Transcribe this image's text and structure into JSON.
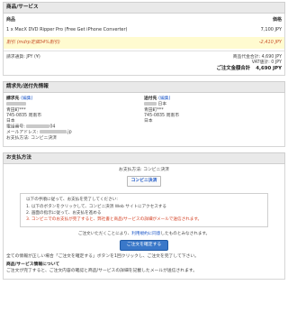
{
  "products": {
    "section_title": "商品/サービス",
    "col_product": "商品",
    "col_price": "価格",
    "item_name": "1 x MacX DVD Ripper Pro (Free Get iPhone Converter)",
    "item_price": "7,100 JPY",
    "discount_label": "割引 (mdrp定価34%割引)",
    "discount_value": "-2,410 JPY",
    "currency_label": "請求通貨: JPY (¥)",
    "subtotal_label": "商品代金合計: 4,690 JPY",
    "vat_label": "VAT値計: 0 JPY",
    "total_label": "ご注文金額合計",
    "total_value": "4,690 JPY"
  },
  "addresses": {
    "section_title": "請求先/送付先情報",
    "billing": {
      "title": "請求先",
      "edit": "(編集)",
      "lines": [
        "青田町***",
        "745-0835 周南市",
        "日本"
      ],
      "phone_label": "電話番号:",
      "phone_suffix": "04",
      "email_label": "メールアドレス:",
      "email_suffix": ".jp",
      "pay_method": "お支払方法: コンビニ決済"
    },
    "shipping": {
      "title": "送付先",
      "edit": "(編集)",
      "name_suffix": "日本",
      "lines": [
        "青田町***",
        "745-0835 周南市",
        "日本"
      ]
    }
  },
  "payment": {
    "section_title": "お支払方法",
    "method_label": "お支払方法: コンビニ決済",
    "konbini_button": "コンビニ決済",
    "instr_lead": "以下の手順に従って、お支払を完了してください:",
    "steps": [
      "1. 以下のボタンをクリックして、コンビニ決済 Web サイトにアクセスする",
      "2. 画面の指示に従って、お支払を進める",
      "3. コンビニでのお支払が完了すると、弊社書と商品/サービスの詳細がメールで送信されます。"
    ],
    "note_before": "ご注文いただくことにより、",
    "note_link": "利用規約に同意",
    "note_after": "したものとみなされます。",
    "confirm_button": "ご注文を確定する",
    "footer_line": "全ての情報が正しい場合「ご注文を確定する」ボタンを1回クリックし、ご注文を完了して下さい。",
    "footer_heading": "商品/サービス情報について",
    "footer_detail": "ご注文が完了すると、ご注文内容の確認と商品/サービスの詳細を記載したメールが送信されます。"
  }
}
